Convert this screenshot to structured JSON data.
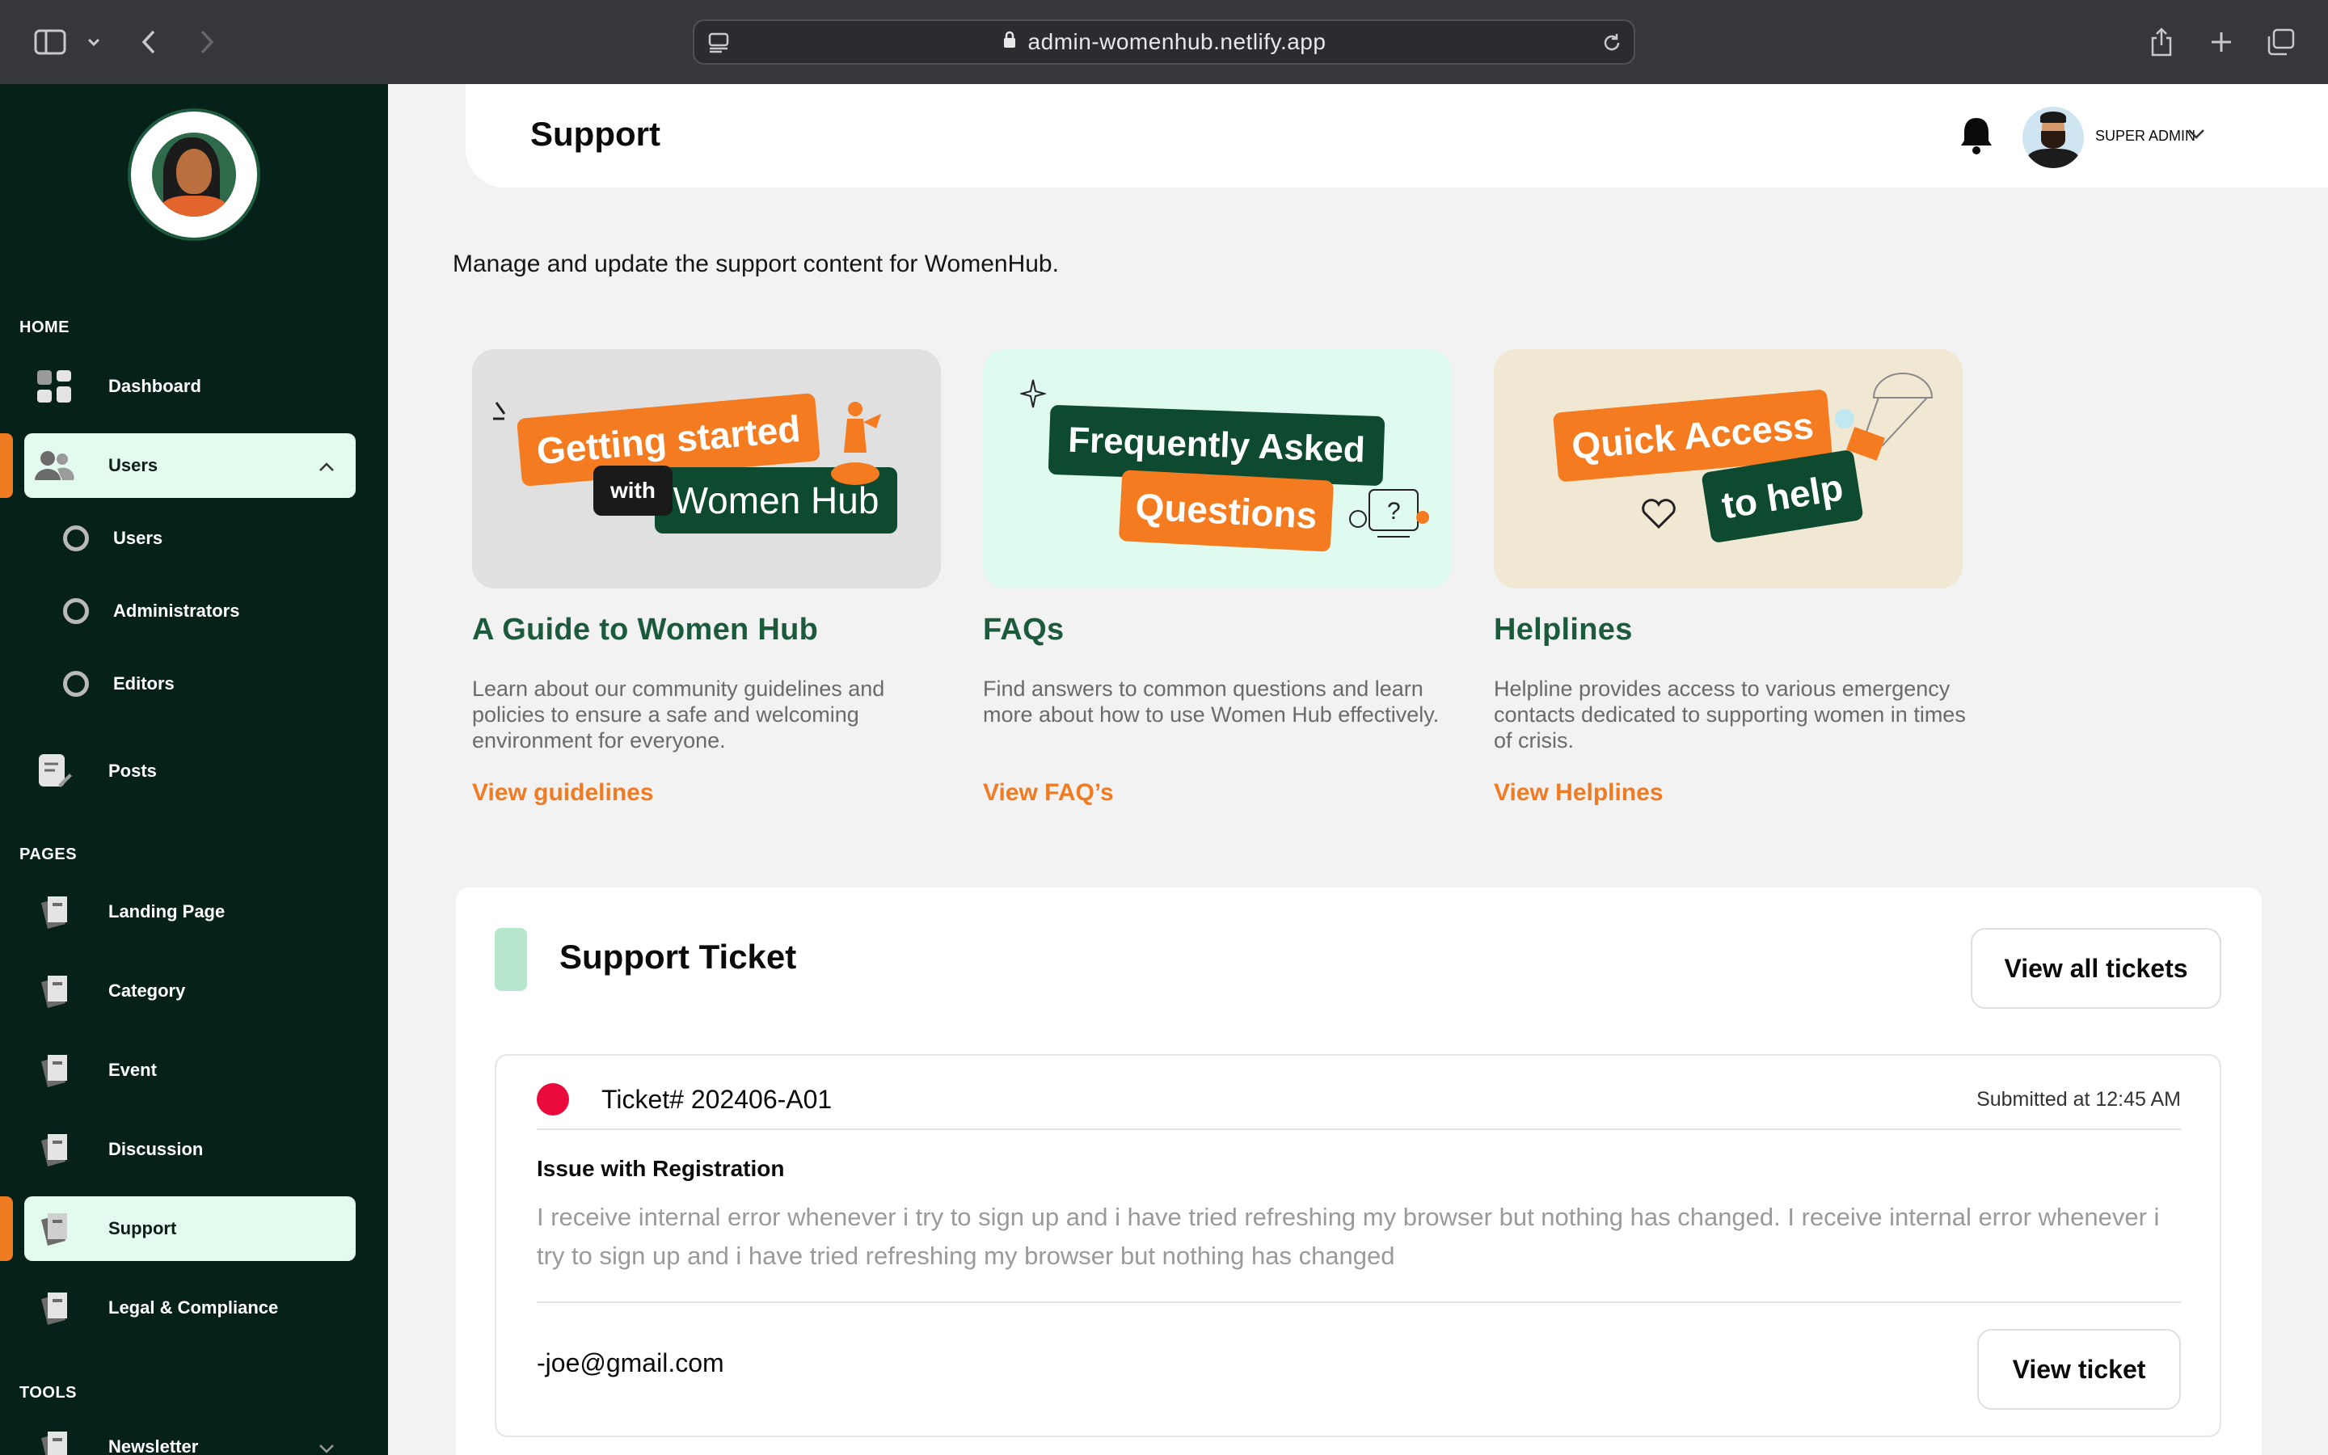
{
  "browser": {
    "url": "admin-womenhub.netlify.app"
  },
  "sidebar": {
    "sections": {
      "home": "HOME",
      "pages": "PAGES",
      "tools": "TOOLS"
    },
    "items": {
      "dashboard": "Dashboard",
      "users": "Users",
      "users_sub": [
        "Users",
        "Administrators",
        "Editors"
      ],
      "posts": "Posts",
      "landing": "Landing Page",
      "category": "Category",
      "event": "Event",
      "discussion": "Discussion",
      "support": "Support",
      "legal": "Legal & Compliance",
      "newsletter": "Newsletter"
    },
    "accent": "#f07b22",
    "active_bg": "#e2fbee"
  },
  "header": {
    "title": "Support",
    "role": "SUPER ADMIN"
  },
  "intro": "Manage and update the support content for WomenHub.",
  "cards": [
    {
      "banner": {
        "line1": "Getting started",
        "with": "with",
        "line2": "Women Hub"
      },
      "title": "A Guide to Women Hub",
      "description": "Learn about our community guidelines and policies to ensure a safe and welcoming environment for everyone.",
      "link": "View guidelines"
    },
    {
      "banner": {
        "line1": "Frequently Asked",
        "line2": "Questions"
      },
      "title": "FAQs",
      "description": "Find answers to common questions and learn more about how to use Women Hub effectively.",
      "link": "View FAQ’s"
    },
    {
      "banner": {
        "line1": "Quick Access",
        "line2": "to help"
      },
      "title": "Helplines",
      "description": "Helpline provides access to various emergency contacts dedicated to supporting women in times of crisis.",
      "link": "View Helplines"
    }
  ],
  "support_ticket": {
    "title": "Support Ticket",
    "view_all": "View all tickets",
    "ticket": {
      "id": "Ticket# 202406-A01",
      "submitted": "Submitted at 12:45 AM",
      "subject": "Issue with Registration",
      "message": "I receive internal error whenever i try to sign up and i have tried refreshing my browser but nothing has changed. I receive internal error whenever i try to sign up and i have tried refreshing my browser but nothing has changed",
      "email": "-joe@gmail.com",
      "view": "View ticket",
      "status_color": "#eb0a3c"
    }
  }
}
